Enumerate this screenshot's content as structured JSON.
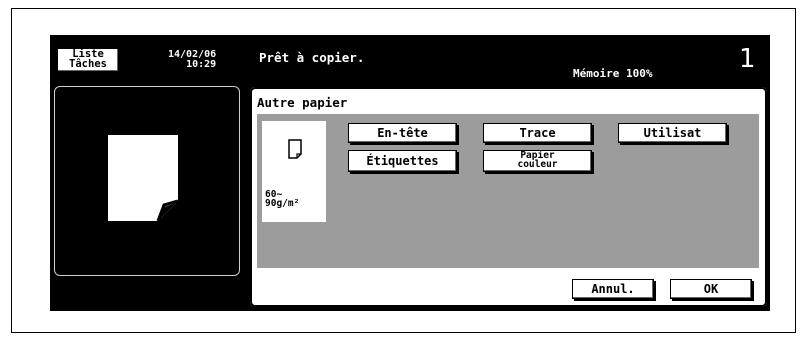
{
  "header": {
    "job_list_line1": "Liste",
    "job_list_line2": "Tâches",
    "date": "14/02/06",
    "time": "10:29",
    "status": "Prêt à copier.",
    "memory": "Mémoire 100%",
    "copies": "1"
  },
  "dialog": {
    "title": "Autre papier",
    "weight_line1": "60~",
    "weight_line2": "90g/m²",
    "options": {
      "letterhead": "En-tête",
      "tracing": "Trace",
      "user": "Utilisat",
      "labels": "Étiquettes",
      "colored_line1": "Papier",
      "colored_line2": "couleur"
    },
    "cancel_label": "Annul.",
    "ok_label": "OK"
  },
  "icons": [
    "document-preview-icon",
    "paper-sheet-icon"
  ],
  "colors": {
    "panel": "#000000",
    "dotted_area": "#ababab",
    "button": "#ffffff"
  }
}
